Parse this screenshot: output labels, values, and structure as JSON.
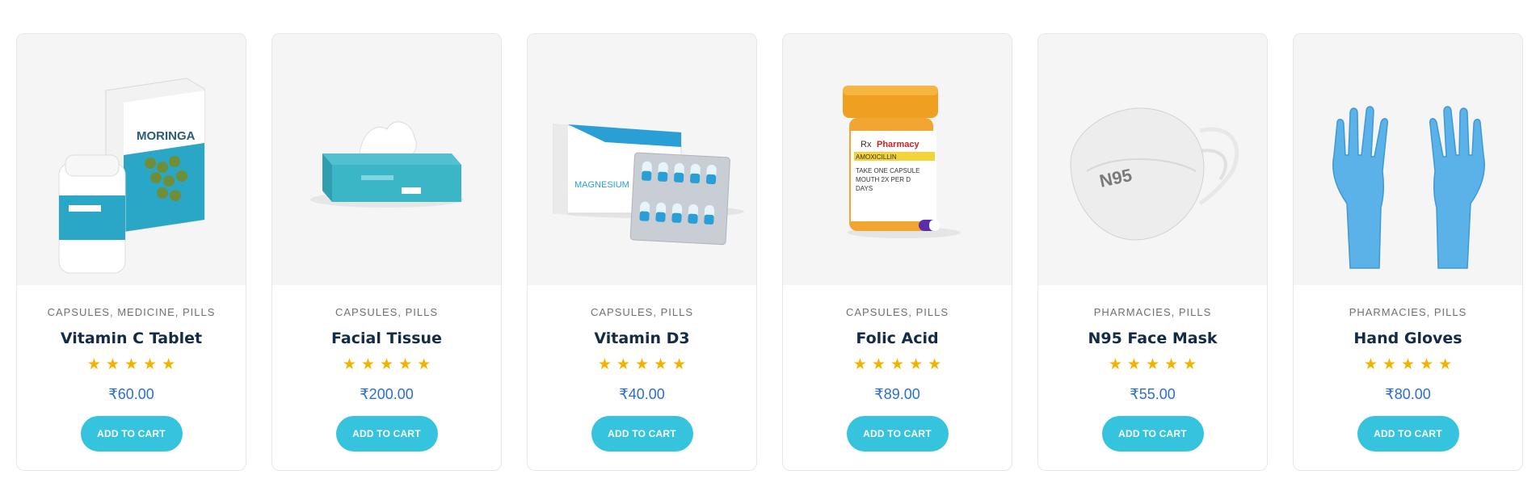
{
  "products": [
    {
      "image_icon": "moringa-supplement-icon",
      "image_label": "MORINGA",
      "categories": [
        "CAPSULES",
        "MEDICINE",
        "PILLS"
      ],
      "title": "Vitamin C Tablet",
      "rating": 5,
      "price": "₹60.00",
      "cart_label": "ADD TO CART"
    },
    {
      "image_icon": "tissue-box-icon",
      "image_label": "",
      "categories": [
        "CAPSULES",
        "PILLS"
      ],
      "title": "Facial Tissue",
      "rating": 5,
      "price": "₹200.00",
      "cart_label": "ADD TO CART"
    },
    {
      "image_icon": "capsule-blister-pack-icon",
      "image_label": "MAGNESIUM",
      "categories": [
        "CAPSULES",
        "PILLS"
      ],
      "title": "Vitamin D3",
      "rating": 5,
      "price": "₹40.00",
      "cart_label": "ADD TO CART"
    },
    {
      "image_icon": "pharmacy-pill-bottle-icon",
      "image_label": "Pharmacy",
      "image_label_lines": [
        "AMOXICILLIN",
        "TAKE ONE CAPSULE",
        "MOUTH 2X PER D",
        "DAYS"
      ],
      "categories": [
        "CAPSULES",
        "PILLS"
      ],
      "title": "Folic Acid",
      "rating": 5,
      "price": "₹89.00",
      "cart_label": "ADD TO CART"
    },
    {
      "image_icon": "n95-mask-icon",
      "image_label": "N95",
      "categories": [
        "PHARMACIES",
        "PILLS"
      ],
      "title": "N95 Face Mask",
      "rating": 5,
      "price": "₹55.00",
      "cart_label": "ADD TO CART"
    },
    {
      "image_icon": "gloves-icon",
      "image_label": "",
      "categories": [
        "PHARMACIES",
        "PILLS"
      ],
      "title": "Hand Gloves",
      "rating": 5,
      "price": "₹80.00",
      "cart_label": "ADD TO CART"
    }
  ],
  "colors": {
    "accent": "#36c3de",
    "price": "#2d6ecf",
    "title": "#132b45",
    "star": "#f0b400",
    "image_bg": "#f5f5f5"
  }
}
